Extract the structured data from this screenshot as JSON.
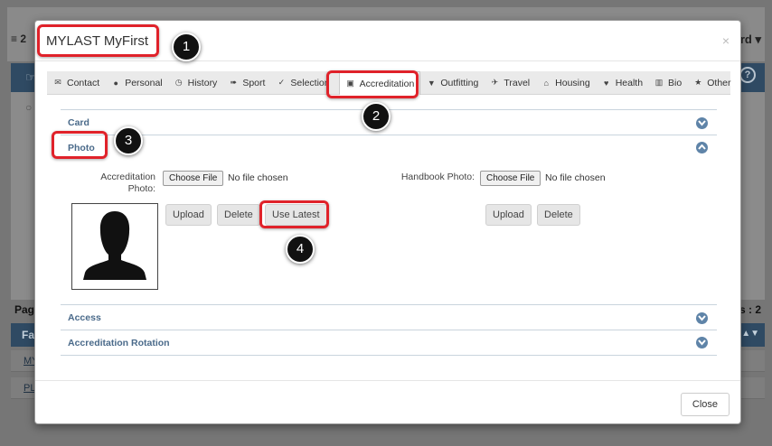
{
  "backdrop": {
    "left_fragment": "2",
    "right_fragment": "rd",
    "pagination_left": "Pag",
    "pagination_right": "s : 2",
    "table_head": "Fa",
    "rows": [
      "MY",
      "PL"
    ]
  },
  "modal": {
    "title": "MYLAST MyFirst",
    "close_symbol": "×",
    "tabs": [
      {
        "label": "Contact",
        "icon": "envelope-icon",
        "glyph": "✉"
      },
      {
        "label": "Personal",
        "icon": "user-icon",
        "glyph": "👤"
      },
      {
        "label": "History",
        "icon": "clock-icon",
        "glyph": "◷"
      },
      {
        "label": "Sport",
        "icon": "runner-icon",
        "glyph": "✈"
      },
      {
        "label": "Selection",
        "icon": "check-icon",
        "glyph": "✓"
      },
      {
        "label": "Accreditation",
        "icon": "id-card-icon",
        "glyph": "▣"
      },
      {
        "label": "Outfitting",
        "icon": "shirt-icon",
        "glyph": "▼"
      },
      {
        "label": "Travel",
        "icon": "plane-icon",
        "glyph": "✈"
      },
      {
        "label": "Housing",
        "icon": "home-icon",
        "glyph": "⌂"
      },
      {
        "label": "Health",
        "icon": "heart-icon",
        "glyph": "♥"
      },
      {
        "label": "Bio",
        "icon": "book-icon",
        "glyph": "▥"
      },
      {
        "label": "Other",
        "icon": "star-icon",
        "glyph": "★"
      }
    ],
    "active_tab": "Accreditation",
    "sections": {
      "card": "Card",
      "photo": "Photo",
      "access": "Access",
      "rotation": "Accreditation Rotation"
    },
    "photo": {
      "accreditation_label_line1": "Accreditation",
      "accreditation_label_line2": "Photo:",
      "handbook_label": "Handbook Photo:",
      "choose_file": "Choose File",
      "no_file": "No file chosen",
      "upload": "Upload",
      "delete": "Delete",
      "use_latest": "Use Latest"
    },
    "footer_close": "Close"
  },
  "callouts": [
    "1",
    "2",
    "3",
    "4"
  ],
  "colors": {
    "highlight": "#e0222a",
    "section_title": "#4a6a8a",
    "toggle": "#5f84a8"
  }
}
